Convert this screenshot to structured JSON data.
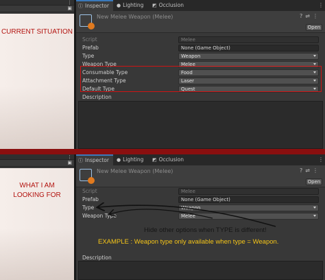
{
  "panels": [
    {
      "id": "top",
      "annotation_title": [
        "CURRENT SITUATION"
      ],
      "tabs": [
        {
          "label": "Inspector",
          "icon": "info-icon",
          "active": true
        },
        {
          "label": "Lighting",
          "icon": "bulb-icon",
          "active": false
        },
        {
          "label": "Occlusion",
          "icon": "occlusion-icon",
          "active": false
        }
      ],
      "object_title": "New Melee Weapon (Melee)",
      "open_label": "Open",
      "fields": [
        {
          "label": "Script",
          "value": "Melee",
          "disabled": true,
          "dropdown": false
        },
        {
          "label": "Prefab",
          "value": "None (Game Object)",
          "disabled": false,
          "dropdown": false
        },
        {
          "label": "Type",
          "value": "Weapon",
          "disabled": false,
          "dropdown": true
        },
        {
          "label": "Weapon Type",
          "value": "Melee",
          "disabled": false,
          "dropdown": true
        },
        {
          "label": "Consumable Type",
          "value": "Food",
          "disabled": false,
          "dropdown": true
        },
        {
          "label": "Attachment Type",
          "value": "Laser",
          "disabled": false,
          "dropdown": true
        },
        {
          "label": "Default Type",
          "value": "Quest",
          "disabled": false,
          "dropdown": true
        }
      ],
      "description_label": "Description"
    },
    {
      "id": "bottom",
      "annotation_title": [
        "WHAT I AM",
        "LOOKING FOR"
      ],
      "tabs": [
        {
          "label": "Inspector",
          "icon": "info-icon",
          "active": true
        },
        {
          "label": "Lighting",
          "icon": "bulb-icon",
          "active": false
        },
        {
          "label": "Occlusion",
          "icon": "occlusion-icon",
          "active": false
        }
      ],
      "object_title": "New Melee Weapon (Melee)",
      "open_label": "Open",
      "fields": [
        {
          "label": "Script",
          "value": "Melee",
          "disabled": true,
          "dropdown": false
        },
        {
          "label": "Prefab",
          "value": "None (Game Object)",
          "disabled": false,
          "dropdown": false
        },
        {
          "label": "Type",
          "value": "Weapon",
          "disabled": false,
          "dropdown": true
        },
        {
          "label": "Weapon Type",
          "value": "Melee",
          "disabled": false,
          "dropdown": true
        }
      ],
      "description_label": "Description"
    }
  ],
  "annotations": {
    "hint": "Hide other options when TYPE  is different!",
    "example": "EXAMPLE : Weapon type only available when type = Weapon."
  },
  "colors": {
    "annotation_red": "#b3130f",
    "highlight_red": "#d01414",
    "example_yellow": "#f5c518",
    "tab_accent": "#3a79bb"
  }
}
